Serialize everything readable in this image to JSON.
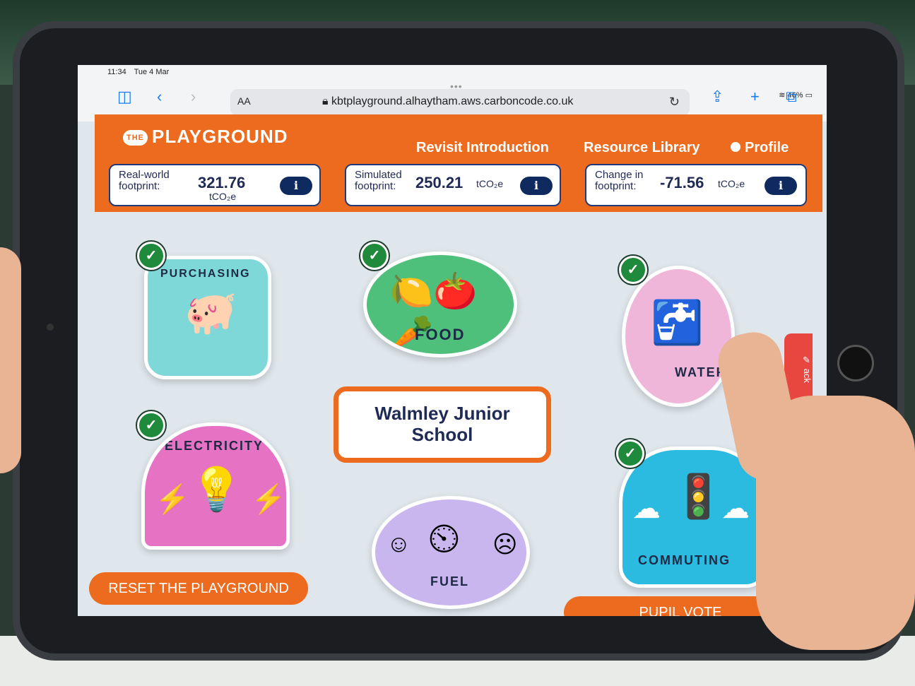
{
  "status_bar": {
    "time": "11:34",
    "date": "Tue 4 Mar",
    "battery": "46%"
  },
  "browser": {
    "text_size_label": "AA",
    "url": "kbtplayground.alhaytham.aws.carboncode.co.uk"
  },
  "app": {
    "logo_small": "THE",
    "logo_main": "PLAYGROUND"
  },
  "nav": {
    "revisit": "Revisit Introduction",
    "resources": "Resource Library",
    "profile": "Profile"
  },
  "metrics": {
    "real": {
      "label": "Real-world footprint:",
      "value": "321.76",
      "unit": "tCO₂e"
    },
    "simulated": {
      "label": "Simulated footprint:",
      "value": "250.21",
      "unit": "tCO₂e"
    },
    "change": {
      "label": "Change in footprint:",
      "value": "-71.56",
      "unit": "tCO₂e"
    },
    "info_label": "i"
  },
  "categories": {
    "purchasing": "PURCHASING",
    "food": "FOOD",
    "water": "WATER",
    "electricity": "ELECTRICITY",
    "fuel": "FUEL",
    "commuting": "COMMUTING"
  },
  "school": {
    "line1": "Walmley Junior",
    "line2": "School"
  },
  "buttons": {
    "reset": "RESET THE PLAYGROUND",
    "vote": "PUPIL VOTE"
  },
  "feedback_tab": "ack",
  "colors": {
    "brand_orange": "#ec6b1e",
    "navy": "#1f2a55",
    "check_green": "#1f8a3b"
  },
  "icons": {
    "check": "✓"
  }
}
